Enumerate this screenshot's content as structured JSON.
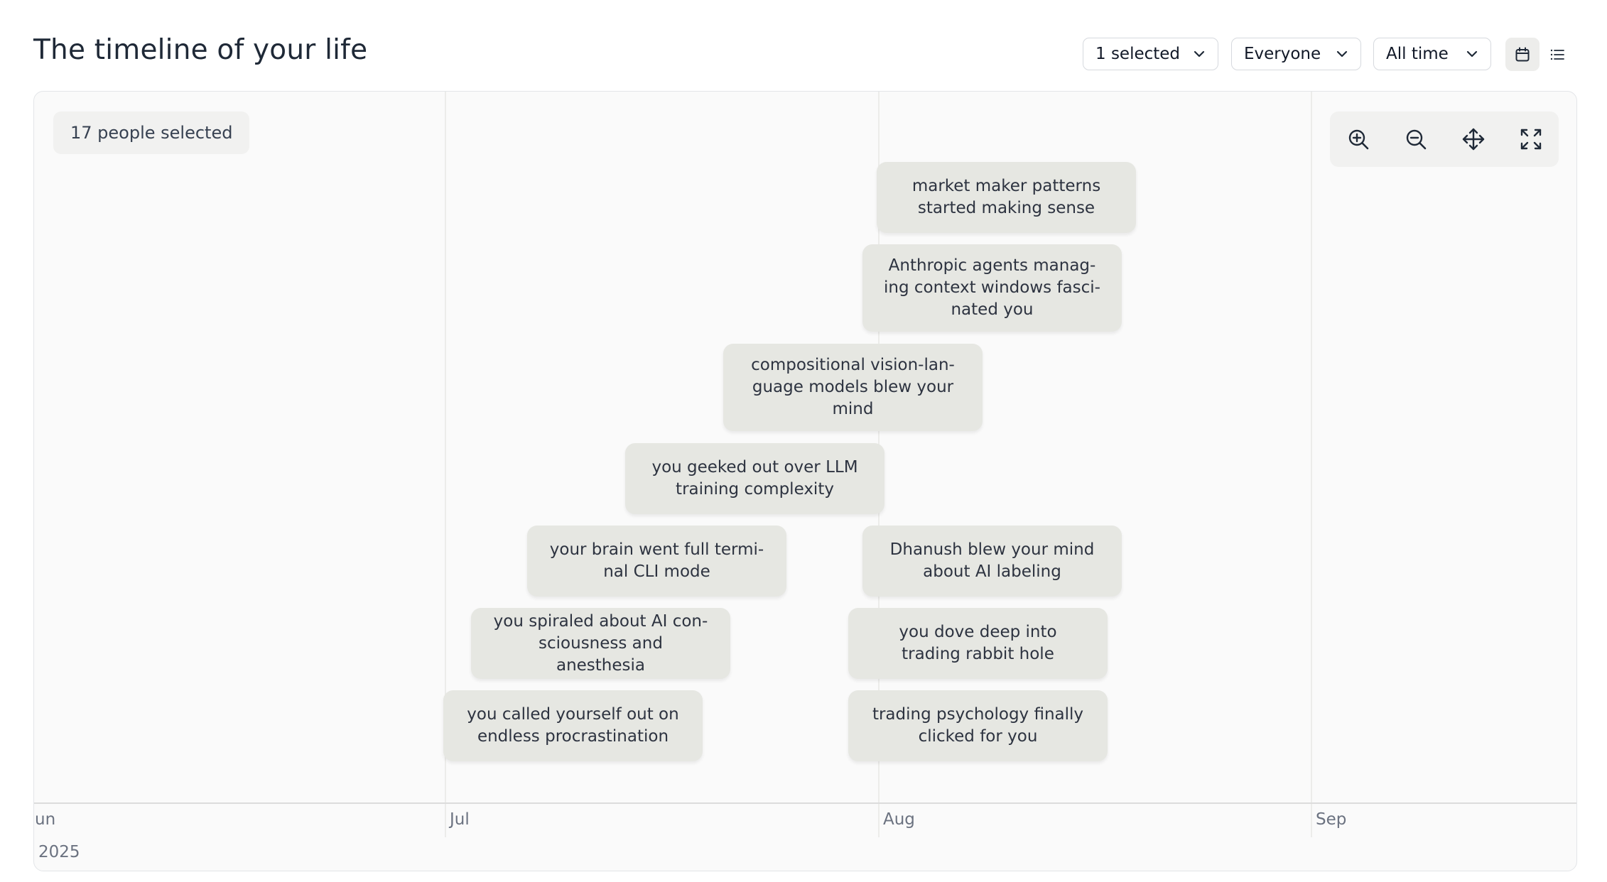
{
  "header": {
    "title": "The timeline of your life",
    "filters": {
      "selection": "1 selected",
      "audience": "Everyone",
      "period": "All time"
    },
    "view_modes": {
      "calendar_icon": "calendar-icon",
      "list_icon": "list-icon"
    }
  },
  "timeline": {
    "people_selected": "17 people selected",
    "controls": [
      "zoom-in-icon",
      "zoom-out-icon",
      "move-icon",
      "fullscreen-icon"
    ],
    "months": [
      "un",
      "Jul",
      "Aug",
      "Sep"
    ],
    "year": "2025",
    "events": [
      {
        "text": "market maker patterns started making sense"
      },
      {
        "text": "Anthropic agents manag­ing context windows fasci­nated you"
      },
      {
        "text": "compositional vision-lan­guage models blew your mind"
      },
      {
        "text": "you geeked out over LLM training complexity"
      },
      {
        "text": "your brain went full termi­nal CLI mode"
      },
      {
        "text": "Dhanush blew your mind about AI labeling"
      },
      {
        "text": "you spiraled about AI con­sciousness and anesthesia"
      },
      {
        "text": "you dove deep into trading rabbit hole"
      },
      {
        "text": "you called yourself out on endless procrastination"
      },
      {
        "text": "trading psychology finally clicked for you"
      }
    ]
  },
  "colors": {
    "card_bg": "#e6e7e2",
    "panel_bg": "#fafafa",
    "text": "#1f2937",
    "muted": "#6b7280",
    "active_view_bg": "#ededeb"
  }
}
